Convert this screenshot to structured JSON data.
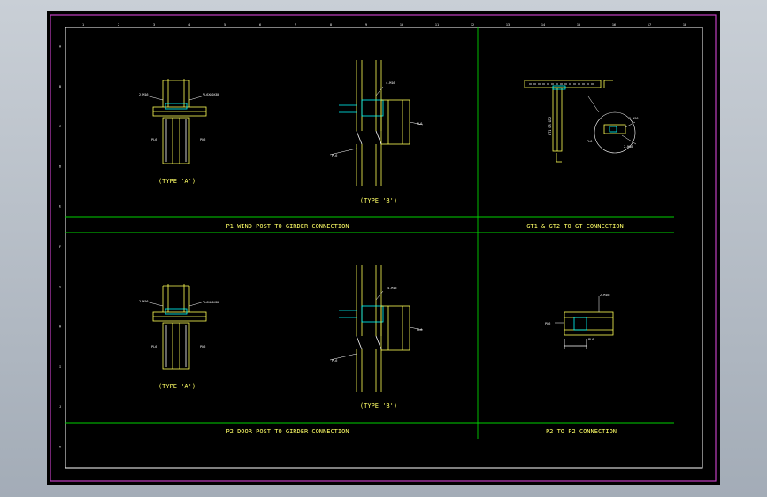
{
  "sections": {
    "p1": "P1 WIND POST TO GIRDER CONNECTION",
    "gt": "GT1 & GT2 TO GT CONNECTION",
    "p2": "P2 DOOR POST TO GIRDER CONNECTION",
    "p2p2": "P2 TO P2 CONNECTION"
  },
  "types": {
    "a_top": "(TYPE 'A')",
    "b_top": "(TYPE 'B')",
    "a_bottom": "(TYPE 'A')",
    "b_bottom": "(TYPE 'B')"
  },
  "ruler_top": [
    "1",
    "2",
    "3",
    "4",
    "5",
    "6",
    "7",
    "8",
    "9",
    "10",
    "11",
    "12",
    "13",
    "14",
    "15",
    "16",
    "17",
    "18"
  ],
  "ruler_left": [
    "A",
    "B",
    "C",
    "D",
    "E",
    "F",
    "G",
    "H",
    "I",
    "J",
    "K"
  ],
  "notes": {
    "n1": "2-M16",
    "n2": "PL6X80X80",
    "n3": "PL6",
    "n4": "PL6",
    "n5": "4-M16",
    "n6": "PL6",
    "n7": "PL6",
    "n8": "GT1 OR GT2",
    "n9": "PL6",
    "n10": "2-M16",
    "n11": "2-M16",
    "n12": "PL6X80X80",
    "n13": "PL6",
    "n14": "PL6",
    "n15": "4-M16",
    "n16": "PL6",
    "n17": "PL6",
    "n18": "2-M16",
    "n19": "PL6",
    "n20": "PL6"
  },
  "colors": {
    "frame": "#c23fc2",
    "border": "#ffffff",
    "grid": "#00d000",
    "drawing": "#ffff55",
    "dims": "#00ffff",
    "background": "#000000"
  }
}
